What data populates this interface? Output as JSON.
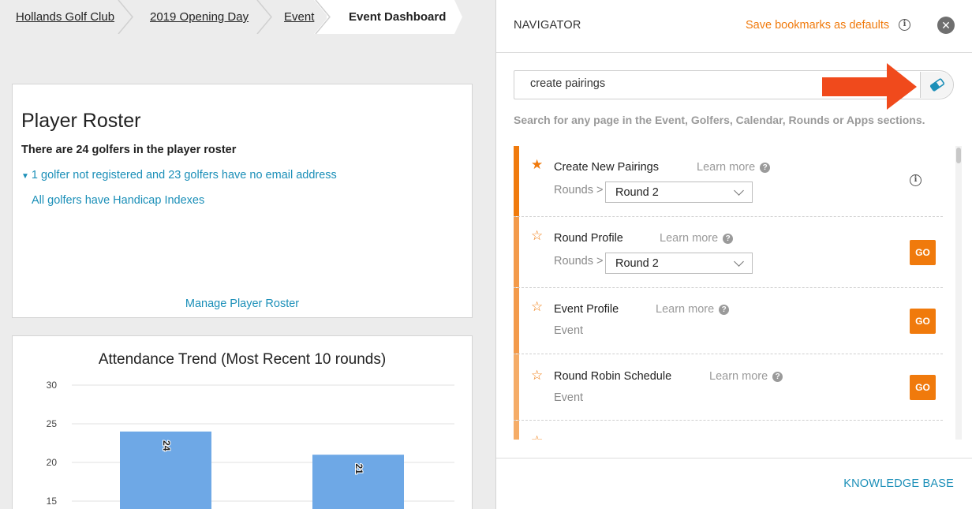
{
  "breadcrumbs": [
    {
      "label": "Hollands Golf Club",
      "link": true
    },
    {
      "label": "2019 Opening Day",
      "link": true
    },
    {
      "label": "Event",
      "link": true
    },
    {
      "label": "Event Dashboard",
      "link": false
    }
  ],
  "roster": {
    "title": "Player Roster",
    "count_text": "There are 24 golfers in the player roster",
    "warning_text": "1 golfer not registered and 23 golfers have no email address",
    "handicap_text": "All golfers have Handicap Indexes",
    "manage_link": "Manage Player Roster"
  },
  "chart_data": {
    "type": "bar",
    "title": "Attendance Trend (Most Recent 10 rounds)",
    "categories": [
      "",
      ""
    ],
    "values": [
      24,
      21
    ],
    "data_labels": [
      "24",
      "21"
    ],
    "y_ticks": [
      "30",
      "25",
      "20",
      "15"
    ],
    "ylim": [
      15,
      30
    ],
    "grid": true,
    "bar_color": "#6ea8e6"
  },
  "navigator": {
    "title": "NAVIGATOR",
    "save_bookmarks": "Save bookmarks as defaults",
    "search_value": "create pairings",
    "search_hint": "Search for any page in the Event, Golfers, Calendar, Rounds or Apps sections.",
    "learn_more": "Learn more",
    "go_label": "GO",
    "results": [
      {
        "name": "Create New Pairings",
        "starred": true,
        "section": "Rounds >",
        "selected": "Round 2"
      },
      {
        "name": "Round Profile",
        "starred": false,
        "section": "Rounds >",
        "selected": "Round 2"
      },
      {
        "name": "Event Profile",
        "starred": false,
        "section": "Event"
      },
      {
        "name": "Round Robin Schedule",
        "starred": false,
        "section": "Event"
      }
    ],
    "knowledge_base": "KNOWLEDGE BASE"
  },
  "colors": {
    "accent": "#f07a0c",
    "link": "#1b8fb8",
    "bar": "#6ea8e6",
    "arrow": "#f04a1c"
  }
}
